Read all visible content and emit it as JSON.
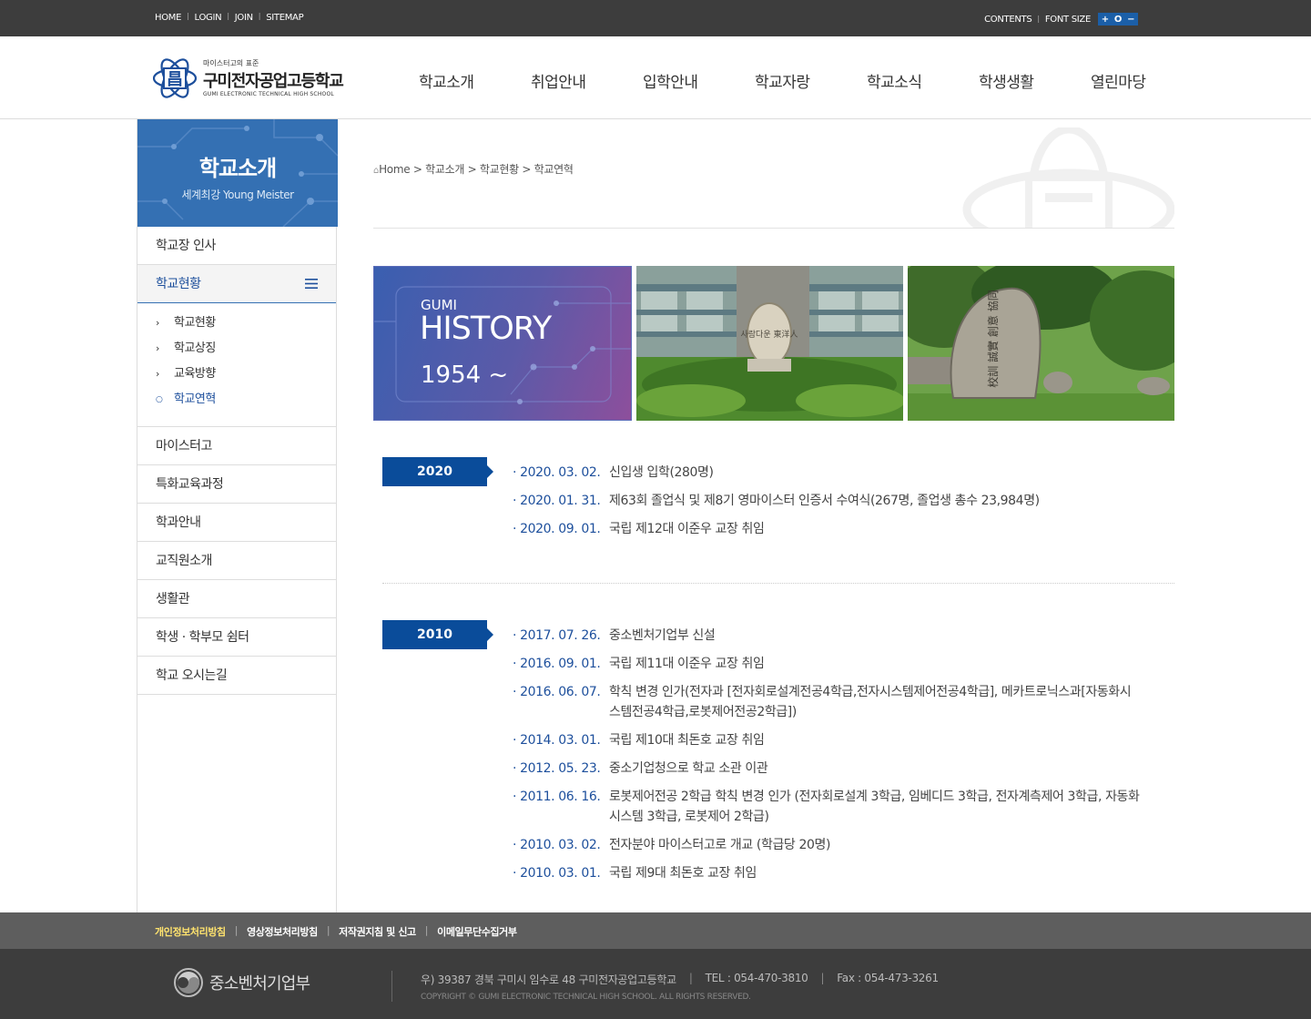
{
  "topbar": {
    "links": [
      "HOME",
      "LOGIN",
      "JOIN",
      "SITEMAP"
    ],
    "contents": "CONTENTS",
    "font_size": "FONT SIZE",
    "font_plus": "+",
    "font_reset": "O",
    "font_minus": "−"
  },
  "header": {
    "logo_tagline": "마이스터고의 표준",
    "logo_name": "구미전자공업고등학교",
    "logo_english": "GUMI ELECTRONIC TECHNICAL HIGH SCHOOL",
    "logo_mark": "昌",
    "gnb": [
      "학교소개",
      "취업안내",
      "입학안내",
      "학교자랑",
      "학교소식",
      "학생생활",
      "열린마당"
    ]
  },
  "sidebar": {
    "title": "학교소개",
    "subtitle": "세계최강 Young Meister",
    "items_before": [
      "학교장 인사"
    ],
    "active": "학교현황",
    "sub": [
      {
        "label": "학교현황",
        "marker": "›"
      },
      {
        "label": "학교상징",
        "marker": "›"
      },
      {
        "label": "교육방향",
        "marker": "›"
      },
      {
        "label": "학교연혁",
        "marker": "○"
      }
    ],
    "items_after": [
      "마이스터고",
      "특화교육과정",
      "학과안내",
      "교직원소개",
      "생활관",
      "학생 · 학부모 쉼터",
      "학교 오시는길"
    ]
  },
  "breadcrumb": {
    "home": "Home",
    "path": [
      "학교소개",
      "학교현황",
      "학교연혁"
    ],
    "separator": ">"
  },
  "banner": {
    "small": "GUMI",
    "big": "HISTORY",
    "year": "1954 ~",
    "stone1_text": "사람다운 東洋人",
    "stone2_text": "校訓 誠實 創意 協同"
  },
  "history": [
    {
      "year": "2020",
      "events": [
        {
          "date": "· 2020. 03. 02.",
          "text": "신입생 입학(280명)"
        },
        {
          "date": "· 2020. 01. 31.",
          "text": "제63회 졸업식 및 제8기 영마이스터 인증서 수여식(267명, 졸업생 총수 23,984명)"
        },
        {
          "date": "· 2020. 09. 01.",
          "text": "국립 제12대 이준우 교장 취임"
        }
      ]
    },
    {
      "year": "2010",
      "events": [
        {
          "date": "· 2017. 07. 26.",
          "text": "중소벤처기업부 신설"
        },
        {
          "date": "· 2016. 09. 01.",
          "text": "국립 제11대 이준우 교장 취임"
        },
        {
          "date": "· 2016. 06. 07.",
          "text": "학칙 변경 인가(전자과 [전자회로설계전공4학급,전자시스템제어전공4학급], 메카트로닉스과[자동화시스템전공4학급,로봇제어전공2학급])"
        },
        {
          "date": "· 2014. 03. 01.",
          "text": "국립 제10대 최돈호 교장 취임"
        },
        {
          "date": "· 2012. 05. 23.",
          "text": "중소기업청으로 학교 소관 이관"
        },
        {
          "date": "· 2011. 06. 16.",
          "text": "로봇제어전공 2학급 학칙 변경 인가 (전자회로설계 3학급, 임베디드 3학급, 전자계측제어 3학급, 자동화시스템 3학급, 로봇제어 2학급)"
        },
        {
          "date": "· 2010. 03. 02.",
          "text": "전자분야 마이스터고로 개교 (학급당 20명)"
        },
        {
          "date": "· 2010. 03. 01.",
          "text": "국립 제9대 최돈호 교장 취임"
        }
      ]
    }
  ],
  "footer_menu": [
    "개인정보처리방침",
    "영상정보처리방침",
    "저작권지침 및 신고",
    "이메일무단수집거부"
  ],
  "footer": {
    "ministry": "중소벤처기업부",
    "address": "우) 39387 경북 구미시 임수로 48 구미전자공업고등학교",
    "tel": "TEL : 054-470-3810",
    "fax": "Fax : 054-473-3261",
    "copyright": "COPYRIGHT © GUMI ELECTRONIC TECHNICAL HIGH SCHOOL. ALL RIGHTS RESERVED."
  },
  "colors": {
    "accent": "#0a4c9a",
    "side_head": "#3470b3",
    "topbar": "#3d3d3d",
    "footer_menu": "#5e5e5e",
    "footer_highlight": "#ffe36e"
  }
}
